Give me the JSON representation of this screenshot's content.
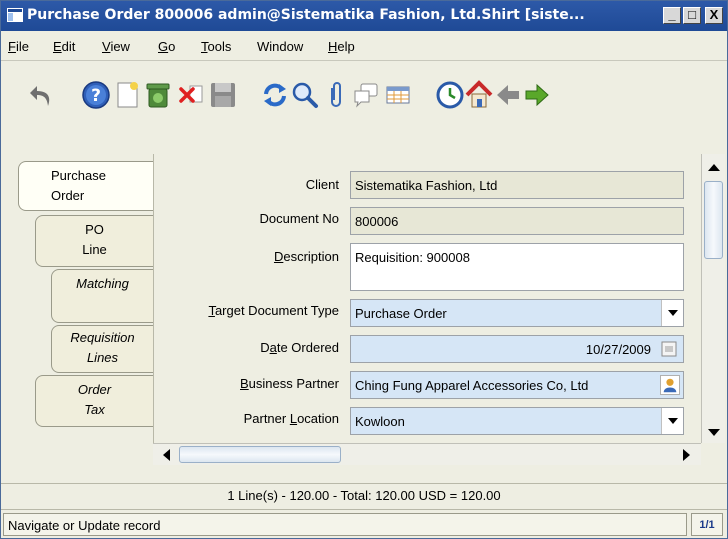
{
  "window": {
    "title": "Purchase Order  800006  admin@Sistematika Fashion, Ltd.Shirt [siste...",
    "controls": {
      "minimize": "_",
      "maximize": "□",
      "close": "X"
    }
  },
  "menu": {
    "items": [
      {
        "label": "File",
        "mnemonic": "F"
      },
      {
        "label": "Edit",
        "mnemonic": "E"
      },
      {
        "label": "View",
        "mnemonic": "V"
      },
      {
        "label": "Go",
        "mnemonic": "G"
      },
      {
        "label": "Tools",
        "mnemonic": "T"
      },
      {
        "label": "Window",
        "mnemonic": ""
      },
      {
        "label": "Help",
        "mnemonic": "H"
      }
    ]
  },
  "toolbar": {
    "icons": [
      "undo-icon",
      "help-icon",
      "new-record-icon",
      "delete-icon",
      "delete-selection-icon",
      "save-icon",
      "refresh-icon",
      "find-icon",
      "attachment-icon",
      "chat-icon",
      "grid-toggle-icon",
      "history-icon",
      "home-icon",
      "previous-record-icon",
      "next-record-icon"
    ]
  },
  "tabs": [
    {
      "label_1": "Purchase",
      "label_2": "Order",
      "active": true
    },
    {
      "label_1": "PO",
      "label_2": "Line",
      "active": false
    },
    {
      "label_1": "Matching",
      "label_2": "",
      "active": false
    },
    {
      "label_1": "Requisition",
      "label_2": "Lines",
      "active": false
    },
    {
      "label_1": "Order",
      "label_2": "Tax",
      "active": false
    }
  ],
  "form": {
    "client": {
      "label": "Client",
      "value": "Sistematika Fashion, Ltd"
    },
    "document_no": {
      "label": "Document No",
      "value": "800006"
    },
    "description": {
      "label_pre": "",
      "label_u": "D",
      "label_post": "escription",
      "value": "Requisition: 900008"
    },
    "target_doc_type": {
      "label_u": "T",
      "label_post": "arget Document Type",
      "value": "Purchase Order"
    },
    "date_ordered": {
      "label_pre": "D",
      "label_u": "a",
      "label_post": "te Ordered",
      "value": "10/27/2009"
    },
    "business_partner": {
      "label_u": "B",
      "label_post": "usiness Partner",
      "value": "Ching Fung Apparel Accessories Co, Ltd"
    },
    "partner_location": {
      "label_pre": "Partner ",
      "label_u": "L",
      "label_post": "ocation",
      "value": "Kowloon"
    }
  },
  "summary": "1 Line(s) - 120.00 -  Total: 120.00 USD  =  120.00",
  "status": {
    "message": "Navigate or Update record",
    "record_count": "1/1"
  },
  "colors": {
    "titlebar": "#2d59a8",
    "window_bg": "#eeeee2",
    "readonly_field": "#e7e7d6",
    "mandatory_field": "#d6e6f6"
  }
}
